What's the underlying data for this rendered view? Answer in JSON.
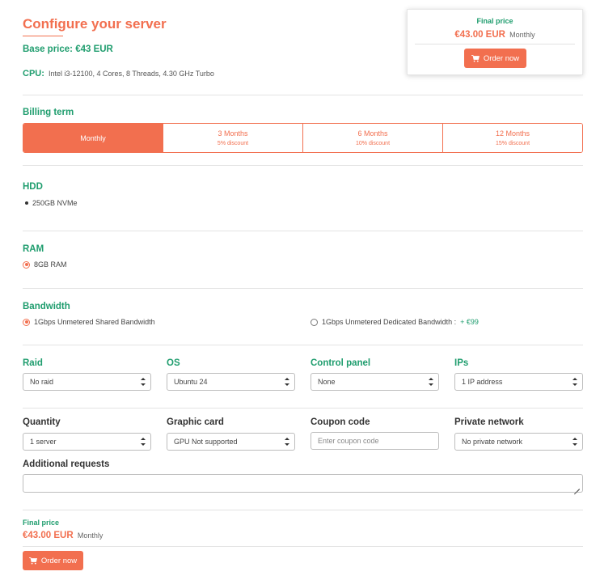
{
  "header": {
    "title": "Configure your server",
    "base_price": "Base price: €43 EUR",
    "cpu_label": "CPU:",
    "cpu_value": "Intel i3-12100, 4 Cores, 8 Threads, 4.30 GHz Turbo"
  },
  "price_card": {
    "label": "Final price",
    "price": "€43.00 EUR",
    "period": "Monthly",
    "order_label": "Order now"
  },
  "billing": {
    "title": "Billing term",
    "options": [
      {
        "label": "Monthly",
        "discount": ""
      },
      {
        "label": "3 Months",
        "discount": "5% discount"
      },
      {
        "label": "6 Months",
        "discount": "10% discount"
      },
      {
        "label": "12 Months",
        "discount": "15% discount"
      }
    ],
    "selected": "Monthly"
  },
  "hdd": {
    "title": "HDD",
    "items": [
      "250GB NVMe"
    ]
  },
  "ram": {
    "title": "RAM",
    "options": [
      {
        "label": "8GB RAM",
        "checked": true
      }
    ]
  },
  "bandwidth": {
    "title": "Bandwidth",
    "options": [
      {
        "label": "1Gbps Unmetered Shared Bandwidth",
        "extra": "",
        "checked": true
      },
      {
        "label": "1Gbps Unmetered Dedicated Bandwidth :",
        "extra": "+ €99",
        "checked": false
      }
    ]
  },
  "row1": {
    "raid": {
      "label": "Raid",
      "value": "No raid"
    },
    "os": {
      "label": "OS",
      "value": "Ubuntu 24"
    },
    "control_panel": {
      "label": "Control panel",
      "value": "None"
    },
    "ips": {
      "label": "IPs",
      "value": "1 IP address"
    }
  },
  "row2": {
    "quantity": {
      "label": "Quantity",
      "value": "1 server"
    },
    "graphic_card": {
      "label": "Graphic card",
      "value": "GPU Not supported"
    },
    "coupon": {
      "label": "Coupon code",
      "placeholder": "Enter coupon code"
    },
    "private_network": {
      "label": "Private network",
      "value": "No private network"
    }
  },
  "additional": {
    "label": "Additional requests"
  },
  "footer": {
    "label": "Final price",
    "price": "€43.00 EUR",
    "period": "Monthly",
    "order_label": "Order now"
  },
  "colors": {
    "accent": "#f26f4f",
    "green": "#1f9d6e"
  }
}
